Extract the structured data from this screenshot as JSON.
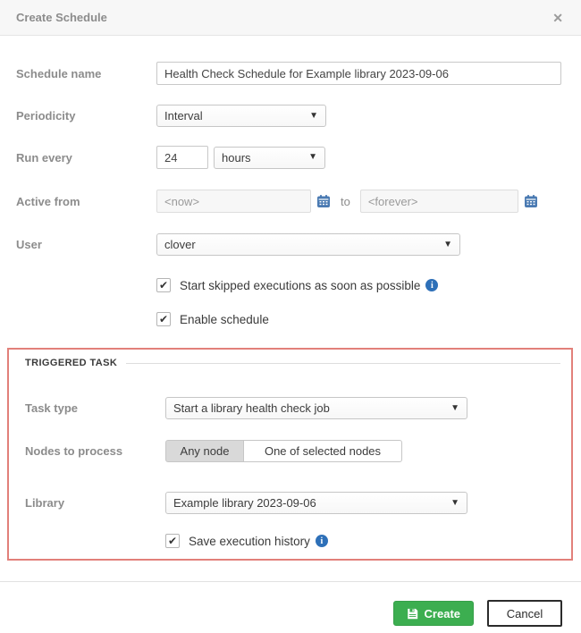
{
  "modal": {
    "title": "Create Schedule"
  },
  "icons": {
    "close": "✕",
    "caret": "▼",
    "check": "✔",
    "info": "i"
  },
  "fields": {
    "schedule_name": {
      "label": "Schedule name",
      "value": "Health Check Schedule for Example library 2023-09-06"
    },
    "periodicity": {
      "label": "Periodicity",
      "value": "Interval"
    },
    "run_every": {
      "label": "Run every",
      "value": "24",
      "unit": "hours"
    },
    "active_from": {
      "label": "Active from",
      "from_placeholder": "<now>",
      "separator": "to",
      "to_placeholder": "<forever>"
    },
    "user": {
      "label": "User",
      "value": "clover"
    },
    "start_skipped": {
      "label": "Start skipped executions as soon as possible",
      "checked": true
    },
    "enable_schedule": {
      "label": "Enable schedule",
      "checked": true
    }
  },
  "triggered_task": {
    "section_title": "TRIGGERED TASK",
    "task_type": {
      "label": "Task type",
      "value": "Start a library health check job"
    },
    "nodes_to_process": {
      "label": "Nodes to process",
      "options": [
        "Any node",
        "One of selected nodes"
      ],
      "selected": "Any node"
    },
    "library": {
      "label": "Library",
      "value": "Example library 2023-09-06"
    },
    "save_history": {
      "label": "Save execution history",
      "checked": true
    }
  },
  "footer": {
    "create_label": "Create",
    "cancel_label": "Cancel"
  },
  "colors": {
    "accent_green": "#3cae50",
    "highlight_red": "#e2807a",
    "info_blue": "#2e70b8",
    "calendar_blue": "#4a7ab2"
  }
}
